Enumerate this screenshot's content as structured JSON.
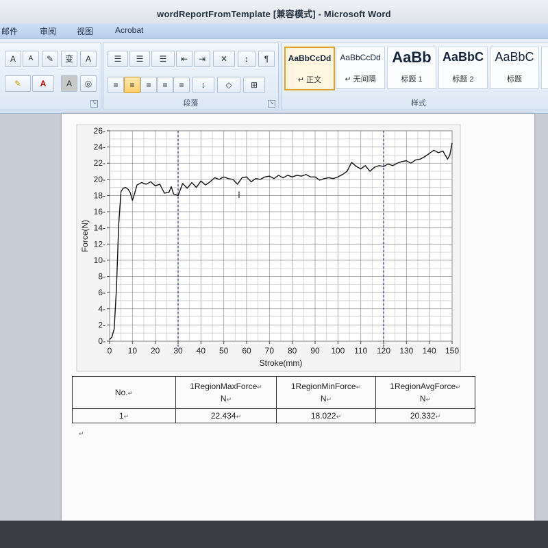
{
  "window": {
    "title": "wordReportFromTemplate [兼容模式] - Microsoft Word"
  },
  "menu": {
    "items": [
      "邮件",
      "审阅",
      "视图",
      "Acrobat"
    ]
  },
  "ribbon": {
    "font_group": {
      "row1": [
        "A",
        "A",
        "✎",
        "变",
        "A"
      ],
      "row2": [
        "✎",
        "A",
        "A",
        "◎"
      ]
    },
    "paragraph_group": {
      "label": "段落",
      "row1": [
        "☰",
        "☰",
        "☰",
        "⇤",
        "⇥",
        "✕",
        "↕",
        "¶"
      ],
      "row2": [
        "≡",
        "≡",
        "≡",
        "≡",
        "≡",
        "↕",
        "◇",
        "⊞"
      ]
    },
    "styles_group": {
      "label": "样式",
      "tiles": [
        {
          "sample": "AaBbCcDd",
          "name": "↵ 正文",
          "active": true
        },
        {
          "sample": "AaBbCcDd",
          "name": "↵ 无间隔",
          "active": false
        },
        {
          "sample": "AaBb",
          "name": "标题 1",
          "active": false
        },
        {
          "sample": "AaBbC",
          "name": "标题 2",
          "active": false
        },
        {
          "sample": "AaBbC",
          "name": "标题",
          "active": false
        },
        {
          "sample": "A",
          "name": "",
          "active": false
        }
      ]
    }
  },
  "chart_data": {
    "type": "line",
    "xlabel": "Stroke(mm)",
    "ylabel": "Force(N)",
    "xlim": [
      0,
      150
    ],
    "ylim": [
      0,
      26
    ],
    "xticks": [
      "0",
      "10",
      "20",
      "30",
      "40",
      "50",
      "60",
      "70",
      "80",
      "90",
      "100",
      "110",
      "120",
      "130",
      "140",
      "150"
    ],
    "yticks": [
      "0",
      "2",
      "4",
      "6",
      "8",
      "10",
      "12",
      "14",
      "16",
      "18",
      "20",
      "22",
      "24",
      "26"
    ],
    "grid": true,
    "region_markers_x": [
      30,
      120
    ],
    "series": [
      {
        "x": [
          0,
          1,
          2,
          3,
          4,
          5,
          6,
          7,
          8,
          9,
          10,
          11,
          12,
          14,
          16,
          18,
          20,
          22,
          24,
          26,
          27,
          28,
          30,
          32,
          34,
          36,
          38,
          40,
          42,
          44,
          46,
          48,
          50,
          52,
          54,
          56,
          58,
          60,
          62,
          64,
          66,
          68,
          70,
          72,
          74,
          76,
          78,
          80,
          82,
          84,
          86,
          88,
          90,
          92,
          94,
          96,
          98,
          100,
          102,
          104,
          106,
          108,
          110,
          112,
          114,
          116,
          118,
          120,
          122,
          124,
          126,
          128,
          130,
          132,
          134,
          136,
          138,
          140,
          142,
          144,
          146,
          148,
          149,
          150
        ],
        "y": [
          0.2,
          0.5,
          1.5,
          6.5,
          14.5,
          18.5,
          18.9,
          19.0,
          18.8,
          18.4,
          17.4,
          18.3,
          19.3,
          19.6,
          19.4,
          19.7,
          19.2,
          19.4,
          18.3,
          18.4,
          19.1,
          18.2,
          18.0,
          19.5,
          18.9,
          19.6,
          19.0,
          19.8,
          19.3,
          19.7,
          20.2,
          20.0,
          20.3,
          20.1,
          20.0,
          19.4,
          20.2,
          20.3,
          19.7,
          20.1,
          20.0,
          20.3,
          20.4,
          20.1,
          20.5,
          20.2,
          20.5,
          20.3,
          20.5,
          20.4,
          20.6,
          20.3,
          20.3,
          19.9,
          20.1,
          20.2,
          20.1,
          20.3,
          20.6,
          21.0,
          22.1,
          21.6,
          21.3,
          21.7,
          21.0,
          21.5,
          21.7,
          21.6,
          21.9,
          21.7,
          22.0,
          22.2,
          22.3,
          22.0,
          22.4,
          22.5,
          22.8,
          23.2,
          23.6,
          23.3,
          23.5,
          22.5,
          23.0,
          24.5
        ]
      }
    ]
  },
  "table": {
    "headers": [
      {
        "line1": "No.",
        "line2": ""
      },
      {
        "line1": "1RegionMaxForce",
        "line2": "N"
      },
      {
        "line1": "1RegionMinForce",
        "line2": "N"
      },
      {
        "line1": "1RegionAvgForce",
        "line2": "N"
      }
    ],
    "rows": [
      [
        "1",
        "22.434",
        "18.022",
        "20.332"
      ]
    ]
  }
}
